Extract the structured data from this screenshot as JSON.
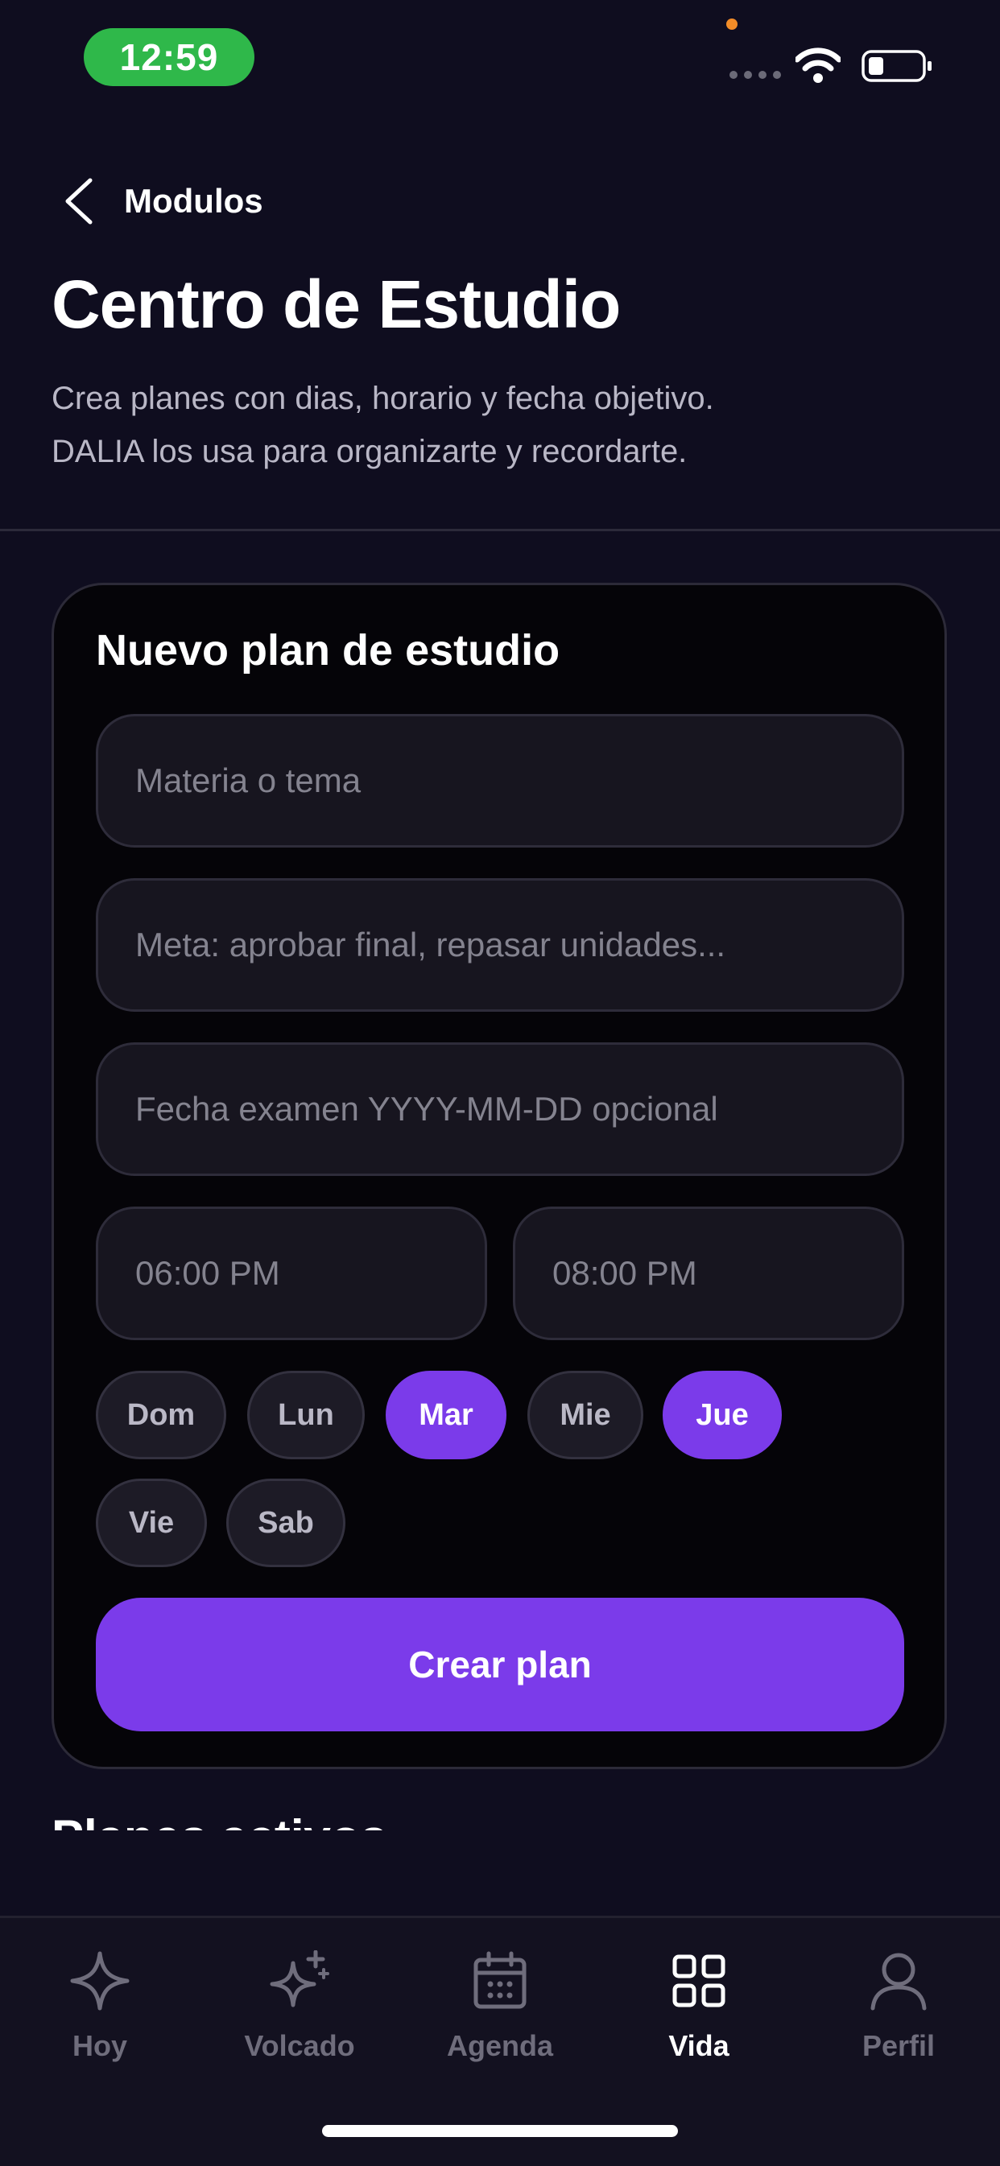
{
  "status_bar": {
    "time": "12:59"
  },
  "header": {
    "back_label": "Modulos",
    "title": "Centro de Estudio",
    "subtitle_line1": "Crea planes con dias, horario y fecha objetivo.",
    "subtitle_line2": "DALIA los usa para organizarte y recordarte."
  },
  "form": {
    "title": "Nuevo plan de estudio",
    "subject_placeholder": "Materia o tema",
    "goal_placeholder": "Meta: aprobar final, repasar unidades...",
    "exam_date_placeholder": "Fecha examen YYYY-MM-DD opcional",
    "start_time": "06:00 PM",
    "end_time": "08:00 PM",
    "days": [
      {
        "label": "Dom",
        "selected": false
      },
      {
        "label": "Lun",
        "selected": false
      },
      {
        "label": "Mar",
        "selected": true
      },
      {
        "label": "Mie",
        "selected": false
      },
      {
        "label": "Jue",
        "selected": true
      },
      {
        "label": "Vie",
        "selected": false
      },
      {
        "label": "Sab",
        "selected": false
      }
    ],
    "submit_label": "Crear plan"
  },
  "next_section_title": "Planes activos",
  "tabs": [
    {
      "label": "Hoy",
      "icon": "sparkle-icon",
      "active": false
    },
    {
      "label": "Volcado",
      "icon": "sparkles-icon",
      "active": false
    },
    {
      "label": "Agenda",
      "icon": "calendar-icon",
      "active": false
    },
    {
      "label": "Vida",
      "icon": "grid-icon",
      "active": true
    },
    {
      "label": "Perfil",
      "icon": "user-icon",
      "active": false
    }
  ],
  "colors": {
    "accent": "#7b3bea",
    "background": "#0f0d1f",
    "status_pill": "#2fb84a"
  }
}
